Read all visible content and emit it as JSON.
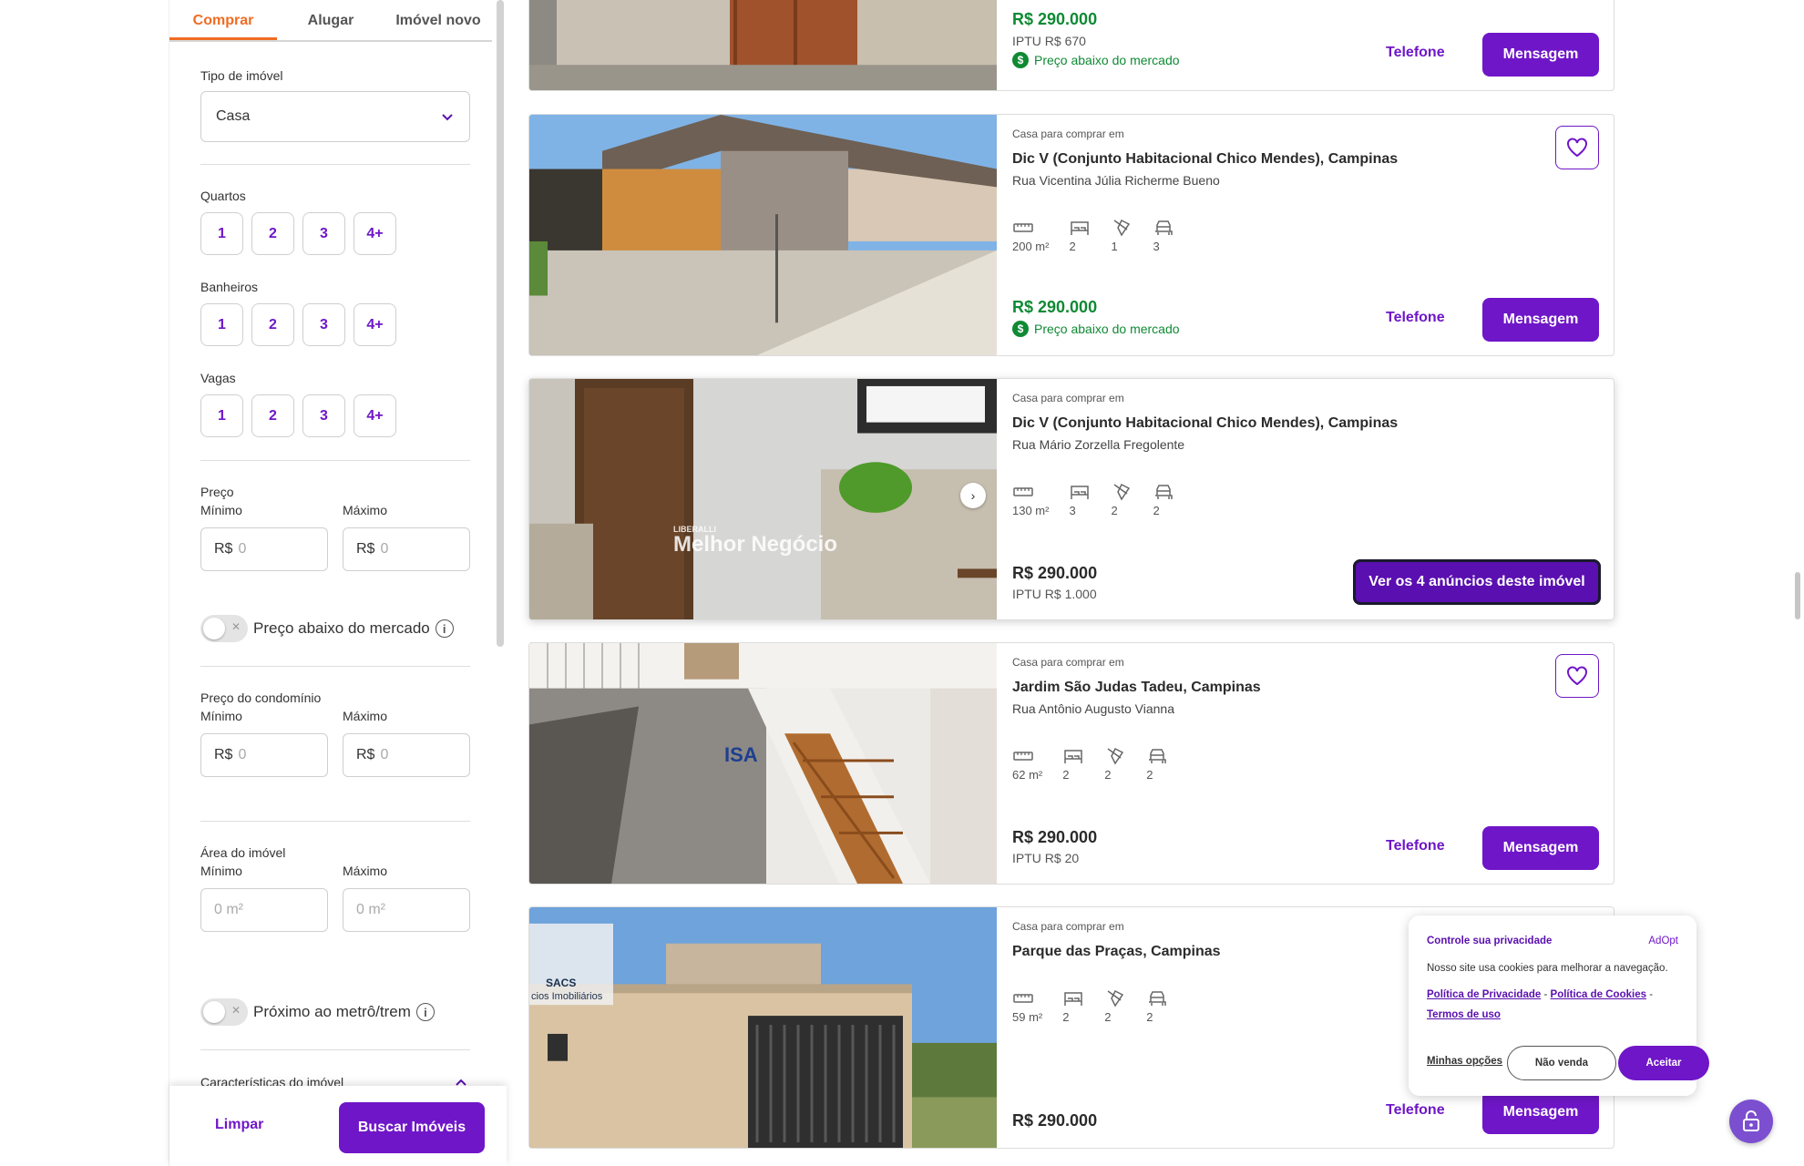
{
  "sidebar": {
    "tabs": [
      "Comprar",
      "Alugar",
      "Imóvel novo"
    ],
    "property_type": {
      "label": "Tipo de imóvel",
      "value": "Casa"
    },
    "bedrooms": {
      "label": "Quartos",
      "options": [
        "1",
        "2",
        "3",
        "4+"
      ]
    },
    "bathrooms": {
      "label": "Banheiros",
      "options": [
        "1",
        "2",
        "3",
        "4+"
      ]
    },
    "parking": {
      "label": "Vagas",
      "options": [
        "1",
        "2",
        "3",
        "4+"
      ]
    },
    "price": {
      "label": "Preço",
      "min_label": "Mínimo",
      "max_label": "Máximo",
      "currency": "R$",
      "placeholder": "0"
    },
    "below_market": {
      "label": "Preço abaixo do mercado",
      "on": false
    },
    "condo_price": {
      "label": "Preço do condomínio",
      "min_label": "Mínimo",
      "max_label": "Máximo",
      "currency": "R$",
      "placeholder": "0"
    },
    "area": {
      "label": "Área do imóvel",
      "min_label": "Mínimo",
      "max_label": "Máximo",
      "placeholder": "0 m²"
    },
    "near_metro": {
      "label": "Próximo ao metrô/trem",
      "on": false
    },
    "features_label": "Características do imóvel",
    "clear_label": "Limpar",
    "search_label": "Buscar Imóveis"
  },
  "listings": [
    {
      "price": "R$ 290.000",
      "iptu": "IPTU R$ 670",
      "below_market": "Preço abaixo do mercado",
      "phone_label": "Telefone",
      "message_label": "Mensagem"
    },
    {
      "type": "Casa para comprar em",
      "title": "Dic V (Conjunto Habitacional Chico Mendes), Campinas",
      "address": "Rua Vicentina Júlia Richerme Bueno",
      "area": "200 m²",
      "bedrooms": "2",
      "bathrooms": "1",
      "parking": "3",
      "price": "R$ 290.000",
      "below_market": "Preço abaixo do mercado",
      "phone_label": "Telefone",
      "message_label": "Mensagem"
    },
    {
      "type": "Casa para comprar em",
      "title": "Dic V (Conjunto Habitacional Chico Mendes), Campinas",
      "address": "Rua Mário Zorzella Fregolente",
      "area": "130 m²",
      "bedrooms": "3",
      "bathrooms": "2",
      "parking": "2",
      "price": "R$ 290.000",
      "iptu": "IPTU R$ 1.000",
      "ads_label": "Ver os 4 anúncios deste imóvel",
      "watermark_small": "LIBERALLI",
      "watermark": "Melhor Negócio"
    },
    {
      "type": "Casa para comprar em",
      "title": "Jardim São Judas Tadeu, Campinas",
      "address": "Rua Antônio Augusto Vianna",
      "area": "62 m²",
      "bedrooms": "2",
      "bathrooms": "2",
      "parking": "2",
      "price": "R$ 290.000",
      "iptu": "IPTU R$ 20",
      "phone_label": "Telefone",
      "message_label": "Mensagem",
      "watermark": "ISA"
    },
    {
      "type": "Casa para comprar em",
      "title": "Parque das Praças, Campinas",
      "area": "59 m²",
      "bedrooms": "2",
      "bathrooms": "2",
      "parking": "2",
      "price": "R$ 290.000",
      "phone_label": "Telefone",
      "message_label": "Mensagem",
      "watermark": "SACS",
      "watermark_sub": "cios Imobiliários"
    }
  ],
  "cookie": {
    "title": "Controle sua privacidade",
    "brand": "AdOpt",
    "message": "Nosso site usa cookies para melhorar a navegação.",
    "privacy_link": "Política de Privacidade",
    "cookies_link": "Política de Cookies",
    "terms_link": "Termos de uso",
    "separator": "-",
    "options_label": "Minhas opções",
    "no_sell_label": "Não venda",
    "accept_label": "Aceitar"
  },
  "colors": {
    "accent": "#6f16c8",
    "tab_active": "#ef6c22",
    "price_good": "#0f8a34"
  },
  "icons": [
    "chevron-down-icon",
    "info-icon",
    "ruler-icon",
    "bed-icon",
    "shower-icon",
    "car-icon",
    "heart-icon",
    "dollar-icon",
    "chevron-right-icon",
    "lock-icon"
  ]
}
